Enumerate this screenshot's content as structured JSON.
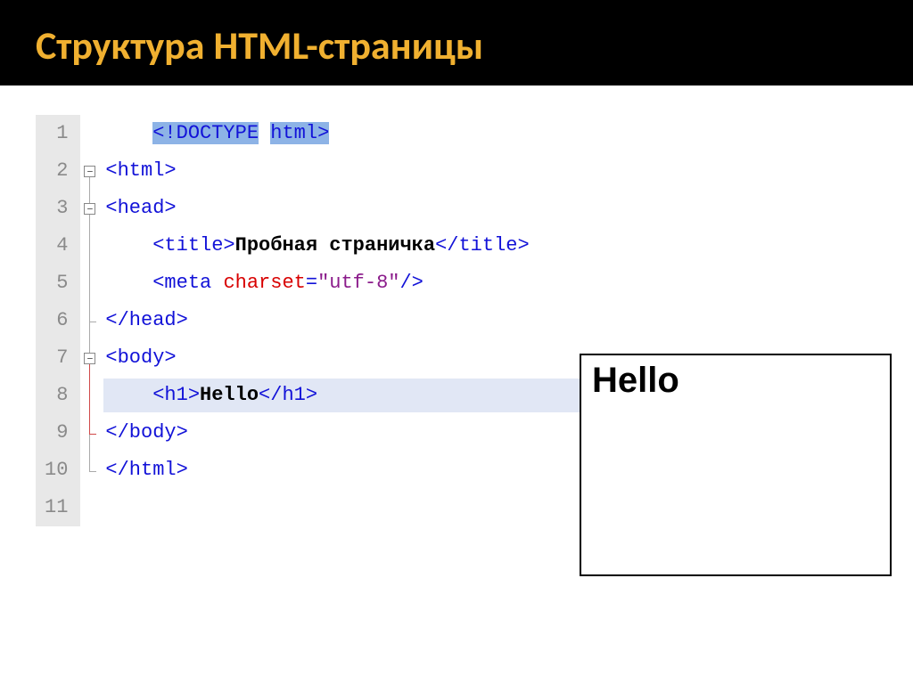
{
  "slide": {
    "title": "Структура HTML-страницы"
  },
  "editor": {
    "line_numbers": [
      "1",
      "2",
      "3",
      "4",
      "5",
      "6",
      "7",
      "8",
      "9",
      "10",
      "11"
    ],
    "lines": {
      "doctype_open": "<",
      "doctype_bang": "!DOCTYPE",
      "doctype_space": " ",
      "doctype_html": "html",
      "doctype_close": ">",
      "html_open": "<html>",
      "head_open": "<head>",
      "title_open": "<title>",
      "title_text": "Пробная страничка",
      "title_close": "</title>",
      "meta_open": "<meta ",
      "meta_attr": "charset",
      "meta_eq": "=",
      "meta_val": "\"utf-8\"",
      "meta_close": "/>",
      "head_close": "</head>",
      "body_open": "<body>",
      "h1_open": "<h1>",
      "h1_text": "Hello",
      "h1_close": "</h1>",
      "body_close": "</body>",
      "html_close": "</html>"
    },
    "fold_minus": "−"
  },
  "preview": {
    "heading": "Hello"
  }
}
